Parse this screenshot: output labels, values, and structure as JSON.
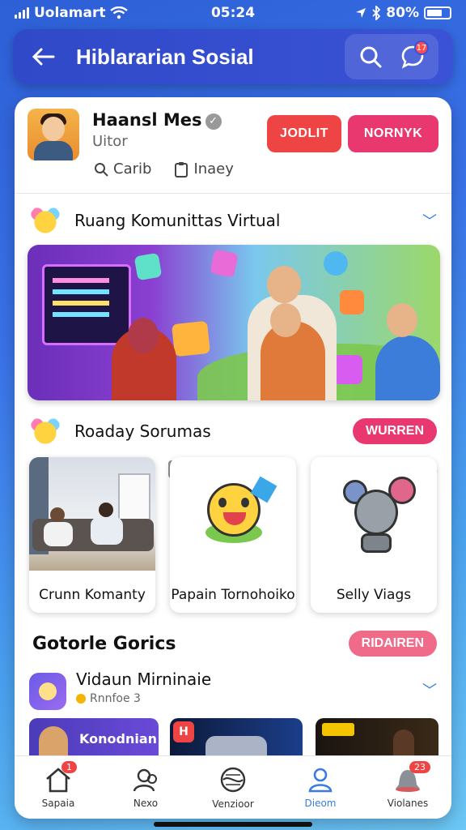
{
  "status_bar": {
    "carrier": "Uolamart",
    "time": "05:24",
    "battery": "80%",
    "icons": [
      "signal-icon",
      "wifi-icon",
      "location-icon",
      "bluetooth-icon",
      "battery-icon"
    ]
  },
  "header": {
    "title": "Hiblararian Sosial",
    "back_icon": "back-arrow-icon",
    "search_icon": "search-icon",
    "chat_icon": "chat-icon",
    "notification_count": "17"
  },
  "profile": {
    "name": "Haansl Mes",
    "subtitle": "Uitor",
    "meta": [
      {
        "icon": "search-icon",
        "label": "Carib"
      },
      {
        "icon": "clipboard-icon",
        "label": "Inaey"
      }
    ],
    "primary_button": "JODLIT",
    "secondary_button": "NORNYK"
  },
  "community": {
    "title": "Ruang Komunittas Virtual"
  },
  "section2": {
    "title": "Roaday Sorumas",
    "button": "WURREN",
    "thumbs": [
      {
        "label": "Crunn Komanty"
      },
      {
        "label": "Papain Tornohoiko"
      },
      {
        "label": "Selly Viags"
      }
    ]
  },
  "section3": {
    "title": "Gotorle Gorics",
    "button": "RIDAIREN",
    "item_title": "Vidaun Mirninaie",
    "item_sub": "Rnnfoe 3",
    "cards": [
      {
        "label": "Konodnian"
      },
      {
        "label": "H"
      },
      {
        "label": ""
      }
    ]
  },
  "tabbar": {
    "tabs": [
      {
        "label": "Sapaia",
        "icon": "home-icon",
        "badge": "1"
      },
      {
        "label": "Nexo",
        "icon": "people-icon",
        "badge": ""
      },
      {
        "label": "Venzioor",
        "icon": "globe-icon",
        "badge": ""
      },
      {
        "label": "Dieom",
        "icon": "user-icon",
        "badge": ""
      },
      {
        "label": "Violanes",
        "icon": "bell-icon",
        "badge": "23"
      }
    ],
    "active_index": 3
  },
  "colors": {
    "accent_red": "#ef4444",
    "accent_pink": "#e8386f",
    "header_blue": "#3a53d6",
    "active_tab": "#3a7be0"
  }
}
